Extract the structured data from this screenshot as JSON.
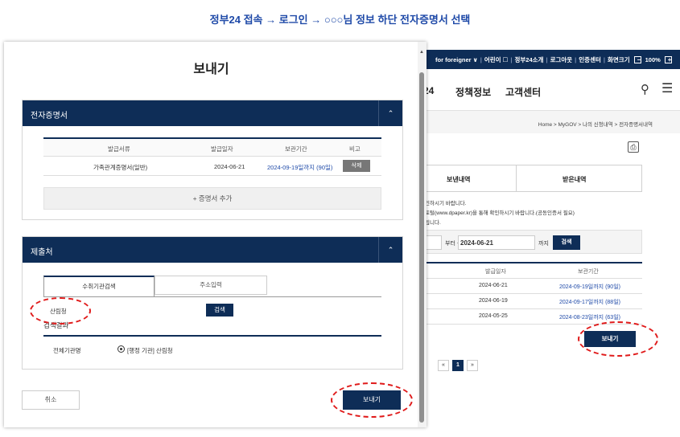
{
  "caption": "정부24 접속 → 로그인 → ○○○님 정보 하단 전자증명서 선택",
  "background_page": {
    "utility_bar": [
      "for foreigner ∨",
      "어린이 ☐",
      "정부24소개",
      "로그아웃",
      "인증센터",
      "화면크기",
      "−",
      "100%",
      "+"
    ],
    "nav": {
      "partial_logo": "24",
      "item1": "정책정보",
      "item2": "고객센터",
      "search_icon": "🔍",
      "menu_icon": "☰"
    },
    "breadcrumb": "Home > MyGOV > 나의 신청내역 > 전자증명서내역",
    "tabs": {
      "sent": "보낸내역",
      "received": "받은내역"
    },
    "notice": [
      "인하시기 바랍니다.",
      "포털(www.dpaper.kr)을 통해 확인하시기 바랍니다.(공동인증서 필요)",
      "됩니다."
    ],
    "filter": {
      "from_label": "부터 ~",
      "date_value": "2024-06-21",
      "to_label": "까지",
      "search_label": "검색"
    },
    "table": {
      "headers": [
        "발급일자",
        "보관기간"
      ],
      "rows": [
        [
          "2024-06-21",
          "2024-09-19일까지 (90일)"
        ],
        [
          "2024-06-19",
          "2024-09-17일까지 (88일)"
        ],
        [
          "2024-05-25",
          "2024-08-23일까지 (63일)"
        ]
      ]
    },
    "send_label": "보내기",
    "pager": [
      "«",
      "1",
      "»"
    ]
  },
  "modal": {
    "title": "보내기",
    "section1": {
      "title": "전자증명서",
      "headers": [
        "발급서류",
        "발급일자",
        "보관기간",
        "비고"
      ],
      "row": {
        "doc": "가족관계증명서(일반)",
        "date": "2024-06-21",
        "period": "2024-09-19일까지 (90일)",
        "delete_label": "삭제"
      },
      "add_label": "+ 증명서 추가"
    },
    "section2": {
      "title": "제출처",
      "tab_recipient": "수취기관검색",
      "tab_address": "주소입력",
      "search_value": "산림청",
      "search_label": "검색",
      "result_label": "검색결과",
      "all_orgs_label": "전체기관명",
      "org_name": "[행정 기관] 산림청"
    },
    "cancel_label": "취소",
    "send_label": "보내기"
  },
  "colors": {
    "navy": "#0e2d57",
    "highlight": "#e01b1b",
    "caption": "#1f4aa8"
  }
}
